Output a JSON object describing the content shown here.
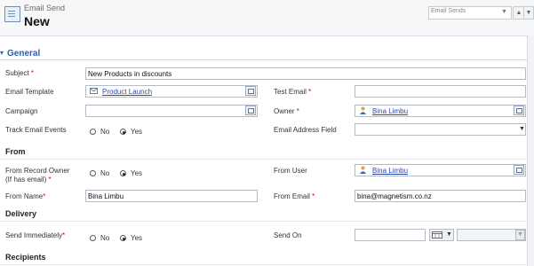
{
  "header": {
    "entity_type": "Email Send",
    "record_title": "New",
    "view_selector": "Email Sends",
    "nav_up": "▲",
    "nav_down": "▼"
  },
  "sections": {
    "general": "General",
    "toggle": "▾",
    "from": "From",
    "delivery": "Delivery",
    "recipients": "Recipients"
  },
  "fields": {
    "subject": {
      "label": "Subject",
      "value": "New Products in discounts"
    },
    "email_template": {
      "label": "Email Template",
      "value": "Product Launch"
    },
    "test_email": {
      "label": "Test Email",
      "value": ""
    },
    "campaign": {
      "label": "Campaign",
      "value": ""
    },
    "owner": {
      "label": "Owner",
      "value": "Bina Limbu"
    },
    "track_email_events": {
      "label": "Track Email Events",
      "options": [
        "No",
        "Yes"
      ],
      "selected": "Yes"
    },
    "email_address_field": {
      "label": "Email Address Field",
      "value": ""
    },
    "from_record_owner": {
      "label_line1": "From Record Owner",
      "label_line2": "(If has email)",
      "options": [
        "No",
        "Yes"
      ],
      "selected": "Yes"
    },
    "from_user": {
      "label": "From User",
      "value": "Bina Limbu"
    },
    "from_name": {
      "label": "From Name",
      "value": "Bina Limbu"
    },
    "from_email": {
      "label": "From Email",
      "value": "bina@magnetism.co.nz"
    },
    "send_immediately": {
      "label": "Send Immediately",
      "options": [
        "No",
        "Yes"
      ],
      "selected": "Yes"
    },
    "send_on": {
      "label": "Send On",
      "date": "",
      "time": ""
    }
  },
  "required_marker": "*",
  "colors": {
    "accent": "#2f5fa7",
    "required": "#dd0000",
    "link": "#2a46b8"
  }
}
